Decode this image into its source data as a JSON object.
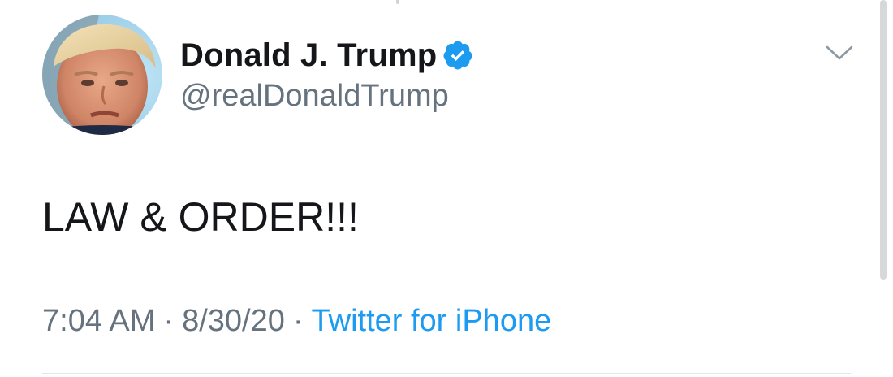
{
  "tweet": {
    "author": {
      "display_name": "Donald J. Trump",
      "handle": "@realDonaldTrump",
      "verified": true,
      "avatar_icon": "profile-photo"
    },
    "text": "LAW & ORDER!!!",
    "time": "7:04 AM",
    "date": "8/30/20",
    "separator": "·",
    "source": "Twitter for iPhone"
  },
  "colors": {
    "text_primary": "#141619",
    "text_secondary": "#66737f",
    "link": "#1d9bf0",
    "verified_badge": "#1d9bf0"
  },
  "icons": {
    "verified": "verified-badge-icon",
    "menu": "chevron-down-icon"
  }
}
